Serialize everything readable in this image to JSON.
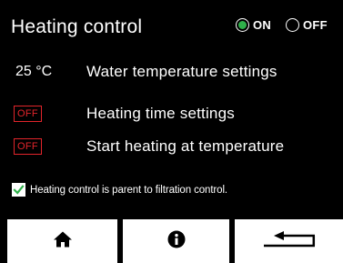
{
  "header": {
    "title": "Heating control",
    "on_label": "ON",
    "off_label": "OFF",
    "selected": "ON"
  },
  "rows": [
    {
      "value": "25 °C",
      "label": "Water temperature settings"
    },
    {
      "badge": "OFF",
      "label": "Heating time settings"
    },
    {
      "badge": "OFF",
      "label": "Start heating at temperature"
    }
  ],
  "checkbox": {
    "label": "Heating control is parent to filtration control.",
    "checked": true
  },
  "nav": {
    "home_icon": "home-icon",
    "info_icon": "info-icon",
    "back_icon": "return-arrow-icon"
  },
  "colors": {
    "accent_green": "#2fb14a",
    "off_red": "#e2252b"
  }
}
